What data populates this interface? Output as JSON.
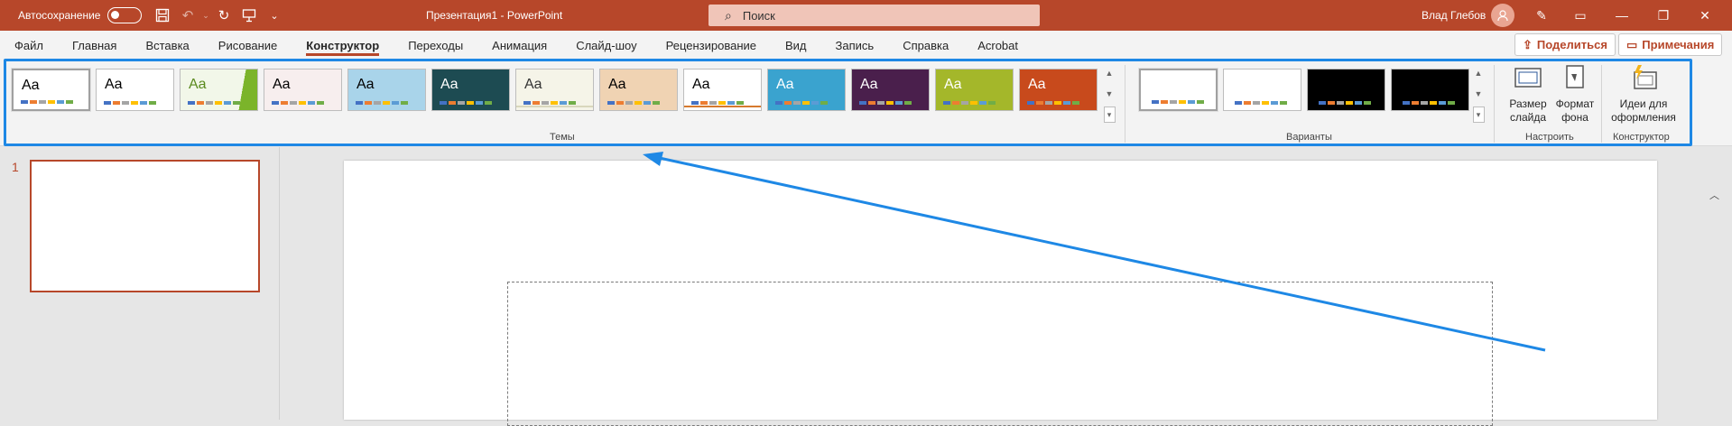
{
  "titlebar": {
    "autosave_label": "Автосохранение",
    "doc_title": "Презентация1 - PowerPoint",
    "search_placeholder": "Поиск",
    "user_name": "Влад Глебов",
    "user_initial": "👤",
    "bg_color": "#b7472a"
  },
  "tabs": [
    "Файл",
    "Главная",
    "Вставка",
    "Рисование",
    "Конструктор",
    "Переходы",
    "Анимация",
    "Слайд-шоу",
    "Рецензирование",
    "Вид",
    "Запись",
    "Справка",
    "Acrobat"
  ],
  "active_tab": "Конструктор",
  "share_label": "Поделиться",
  "comments_label": "Примечания",
  "ribbon": {
    "themes_label": "Темы",
    "variants_label": "Варианты",
    "customize_label": "Настроить",
    "designer_label": "Конструктор",
    "slide_size_label": "Размер слайда",
    "format_bg_label": "Формат фона",
    "design_ideas_label": "Идеи для оформления",
    "theme_thumb_text": "Aa"
  },
  "themes": [
    {
      "bg": "#ffffff",
      "fg": "#000000",
      "accent": "#ffffff"
    },
    {
      "bg": "#ffffff",
      "fg": "#000000",
      "accent": "#ffffff"
    },
    {
      "bg": "#f2f7e9",
      "fg": "#5a8a1e",
      "accent": "#7bb42a"
    },
    {
      "bg": "#f7eeee",
      "fg": "#000000",
      "accent": "#c88a8a"
    },
    {
      "bg": "#a9d4ea",
      "fg": "#000000",
      "accent": "#2e86c1"
    },
    {
      "bg": "#1d4b52",
      "fg": "#ffffff",
      "accent": "#2a6e77"
    },
    {
      "bg": "#f5f4e8",
      "fg": "#333333",
      "accent": "#d9d7bd"
    },
    {
      "bg": "#f0d3b3",
      "fg": "#000000",
      "accent": "#e2a66c"
    },
    {
      "bg": "#ffffff",
      "fg": "#000000",
      "accent": "#d67a2e"
    },
    {
      "bg": "#3aa3cf",
      "fg": "#ffffff",
      "accent": "#1f7aa8"
    },
    {
      "bg": "#4a1f4c",
      "fg": "#ffffff",
      "accent": "#a0307f"
    },
    {
      "bg": "#a4b72a",
      "fg": "#ffffff",
      "accent": "#8aa01e"
    },
    {
      "bg": "#c84a1c",
      "fg": "#ffffff",
      "accent": "#e8772e"
    }
  ],
  "variants": [
    {
      "bg": "#ffffff"
    },
    {
      "bg": "#ffffff"
    },
    {
      "bg": "#000000"
    },
    {
      "bg": "#000000"
    }
  ],
  "slide_number": "1",
  "highlight_color": "#1e88e5"
}
